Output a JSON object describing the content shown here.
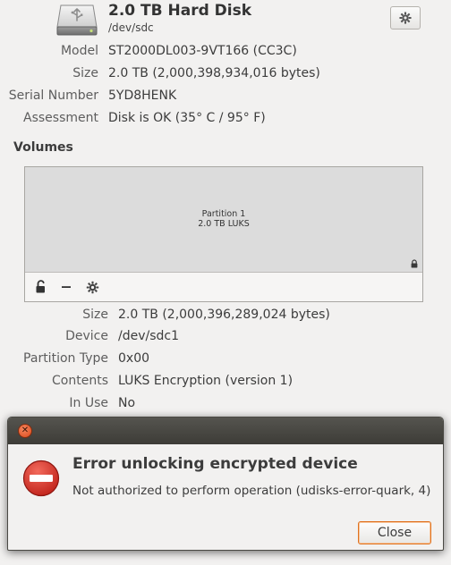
{
  "disk": {
    "title": "2.0 TB Hard Disk",
    "device": "/dev/sdc",
    "settings_icon": "gear-icon",
    "properties": [
      {
        "label": "Model",
        "value": "ST2000DL003-9VT166 (CC3C)"
      },
      {
        "label": "Size",
        "value": "2.0 TB (2,000,398,934,016 bytes)"
      },
      {
        "label": "Serial Number",
        "value": "5YD8HENK"
      },
      {
        "label": "Assessment",
        "value": "Disk is OK (35° C / 95° F)"
      }
    ]
  },
  "volumes": {
    "heading": "Volumes",
    "partition": {
      "name": "Partition 1",
      "size": "2.0 TB LUKS",
      "lock_icon": "lock-icon",
      "fill_color": "#dcdcdc"
    },
    "toolbar": {
      "unlock_icon": "unlock-icon",
      "delete_icon": "minus-icon",
      "settings_icon": "gear-icon"
    },
    "properties": [
      {
        "label": "Size",
        "value": "2.0 TB (2,000,396,289,024 bytes)"
      },
      {
        "label": "Device",
        "value": "/dev/sdc1"
      },
      {
        "label": "Partition Type",
        "value": "0x00"
      },
      {
        "label": "Contents",
        "value": "LUKS Encryption (version 1)"
      },
      {
        "label": "In Use",
        "value": "No"
      }
    ]
  },
  "dialog": {
    "title": "Error unlocking encrypted device",
    "message": "Not authorized to perform operation (udisks-error-quark, 4)",
    "close_label": "Close",
    "titlebar_close_icon": "close-icon",
    "error_icon": "error-icon",
    "accent_color": "#e0721f",
    "error_color": "#d42d20"
  }
}
